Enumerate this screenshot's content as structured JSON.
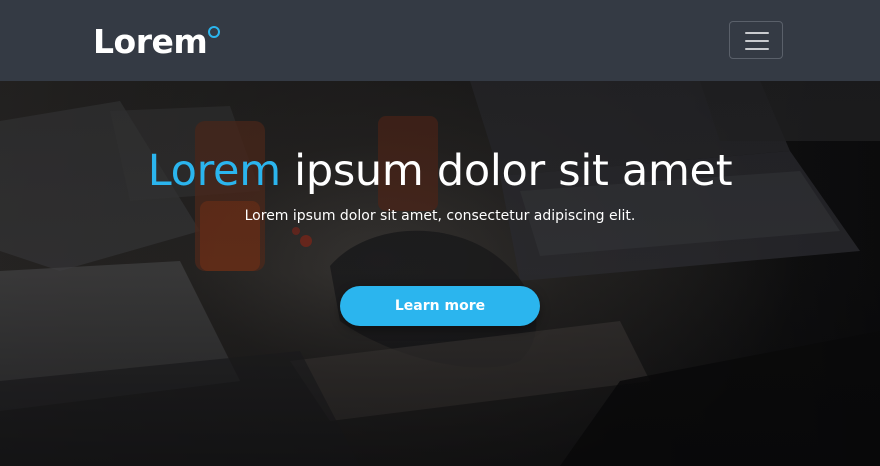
{
  "navbar": {
    "brand": "Lorem",
    "menu_icon": "hamburger-menu-icon"
  },
  "hero": {
    "title_accent": "Lorem",
    "title_rest": " ipsum dolor sit amet",
    "subtitle": "Lorem ipsum dolor sit amet, consectetur adipiscing elit.",
    "cta_label": "Learn more",
    "background": "dark photo of a desk with laptop, notebooks and tea cups"
  },
  "colors": {
    "navbar_bg": "#343a44",
    "accent": "#2bb5ee",
    "text": "#ffffff"
  }
}
